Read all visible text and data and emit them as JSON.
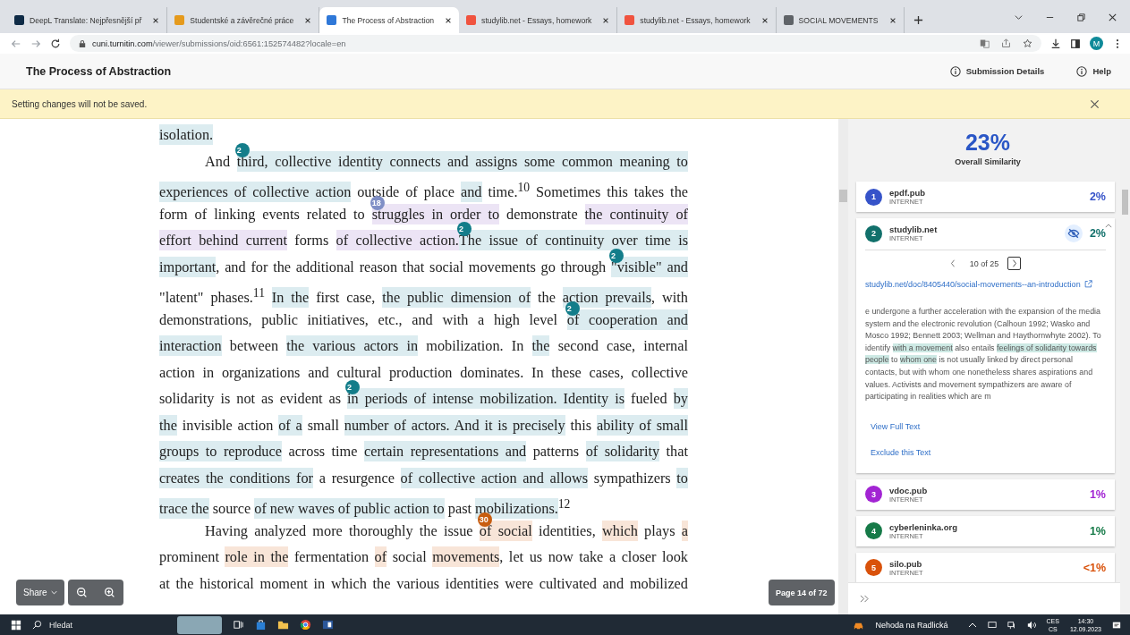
{
  "browser": {
    "tabs": [
      {
        "title": "DeepL Translate: Nejpřesnější př",
        "color": "#0f2b46",
        "selected": false
      },
      {
        "title": "Studentské a závěrečné práce",
        "color": "#e59a1c",
        "selected": false
      },
      {
        "title": "The Process of Abstraction",
        "color": "#2f78d8",
        "selected": true
      },
      {
        "title": "studylib.net - Essays, homework",
        "color": "#f0533f",
        "selected": false
      },
      {
        "title": "studylib.net - Essays, homework",
        "color": "#f0533f",
        "selected": false
      },
      {
        "title": "SOCIAL MOVEMENTS",
        "color": "#5f6368",
        "selected": false
      }
    ],
    "url": {
      "host": "cuni.turnitin.com",
      "path": "/viewer/submissions/oid:6561:152574482?locale=en"
    },
    "profile_initial": "M"
  },
  "app_header": {
    "title": "The Process of Abstraction",
    "actions": [
      "Submission Details",
      "Help"
    ]
  },
  "banner": {
    "message": "Setting changes will not be saved."
  },
  "document": {
    "lines": [
      {
        "indent": false,
        "last": true,
        "segments": [
          {
            "kind": "highlight",
            "text": "isolation.",
            "color": "#dcecf0"
          }
        ]
      },
      {
        "indent": true,
        "last": false,
        "segments": [
          {
            "kind": "text",
            "text": "And "
          },
          {
            "kind": "badge",
            "text": "2",
            "color": "#137d8a"
          },
          {
            "kind": "highlight",
            "text": "third, collective identity connects and assigns some common meaning to",
            "color": "#dcecf0"
          }
        ]
      },
      {
        "indent": false,
        "last": false,
        "segments": [
          {
            "kind": "highlight",
            "text": "experiences of collective action",
            "color": "#dcecf0"
          },
          {
            "kind": "text",
            "text": " outside of place "
          },
          {
            "kind": "highlight",
            "text": "and",
            "color": "#dcecf0"
          },
          {
            "kind": "text",
            "text": " time.$^{10}$ Sometimes this takes the"
          }
        ]
      },
      {
        "indent": false,
        "last": false,
        "segments": [
          {
            "kind": "text",
            "text": "form of linking events related to "
          },
          {
            "kind": "badge",
            "text": "18",
            "color": "#7f8fc6"
          },
          {
            "kind": "highlight",
            "text": "struggles in order to",
            "color": "#ece4f5"
          },
          {
            "kind": "text",
            "text": " demonstrate "
          },
          {
            "kind": "highlight",
            "text": "the continuity of",
            "color": "#ece4f5"
          }
        ]
      },
      {
        "indent": false,
        "last": false,
        "segments": [
          {
            "kind": "highlight",
            "text": "effort behind current",
            "color": "#ece4f5"
          },
          {
            "kind": "text",
            "text": " forms "
          },
          {
            "kind": "highlight",
            "text": "of collective action.",
            "color": "#ece4f5"
          },
          {
            "kind": "badge",
            "text": "2",
            "color": "#137d8a"
          },
          {
            "kind": "highlight",
            "text": "The issue of continuity over time is",
            "color": "#dcecf0"
          }
        ]
      },
      {
        "indent": false,
        "last": false,
        "segments": [
          {
            "kind": "highlight",
            "text": "important",
            "color": "#dcecf0"
          },
          {
            "kind": "text",
            "text": ", and for the additional reason that social movements go through "
          },
          {
            "kind": "badge",
            "text": "2",
            "color": "#137d8a"
          },
          {
            "kind": "highlight",
            "text": "\"visible\" and",
            "color": "#dcecf0"
          }
        ]
      },
      {
        "indent": false,
        "last": false,
        "segments": [
          {
            "kind": "text",
            "text": "\"latent\" phases.$^{11}$ "
          },
          {
            "kind": "highlight",
            "text": "In the",
            "color": "#dcecf0"
          },
          {
            "kind": "text",
            "text": " first case, "
          },
          {
            "kind": "highlight",
            "text": "the public dimension of",
            "color": "#dcecf0"
          },
          {
            "kind": "text",
            "text": " the "
          },
          {
            "kind": "highlight",
            "text": "action prevails",
            "color": "#dcecf0"
          },
          {
            "kind": "text",
            "text": ", with"
          }
        ]
      },
      {
        "indent": false,
        "last": false,
        "segments": [
          {
            "kind": "text",
            "text": "demonstrations, public initiatives, etc., and with a high level "
          },
          {
            "kind": "badge",
            "text": "2",
            "color": "#137d8a"
          },
          {
            "kind": "highlight",
            "text": "of cooperation and",
            "color": "#dcecf0"
          }
        ]
      },
      {
        "indent": false,
        "last": false,
        "segments": [
          {
            "kind": "highlight",
            "text": "interaction",
            "color": "#dcecf0"
          },
          {
            "kind": "text",
            "text": " between "
          },
          {
            "kind": "highlight",
            "text": "the various actors in",
            "color": "#dcecf0"
          },
          {
            "kind": "text",
            "text": " mobilization. In "
          },
          {
            "kind": "highlight",
            "text": "the",
            "color": "#dcecf0"
          },
          {
            "kind": "text",
            "text": " second case, internal"
          }
        ]
      },
      {
        "indent": false,
        "last": false,
        "segments": [
          {
            "kind": "text",
            "text": "action in organizations and cultural production dominates. In these cases, collective"
          }
        ]
      },
      {
        "indent": false,
        "last": false,
        "segments": [
          {
            "kind": "text",
            "text": "solidarity is not as evident as "
          },
          {
            "kind": "badge",
            "text": "2",
            "color": "#137d8a"
          },
          {
            "kind": "highlight",
            "text": "in periods of intense mobilization. Identity is",
            "color": "#dcecf0"
          },
          {
            "kind": "text",
            "text": " fueled "
          },
          {
            "kind": "highlight",
            "text": "by",
            "color": "#dcecf0"
          }
        ]
      },
      {
        "indent": false,
        "last": false,
        "segments": [
          {
            "kind": "highlight",
            "text": "the",
            "color": "#dcecf0"
          },
          {
            "kind": "text",
            "text": " invisible action "
          },
          {
            "kind": "highlight",
            "text": "of a",
            "color": "#dcecf0"
          },
          {
            "kind": "text",
            "text": " small "
          },
          {
            "kind": "highlight",
            "text": "number of actors. And it is precisely",
            "color": "#dcecf0"
          },
          {
            "kind": "text",
            "text": " this "
          },
          {
            "kind": "highlight",
            "text": "ability of small",
            "color": "#dcecf0"
          }
        ]
      },
      {
        "indent": false,
        "last": false,
        "segments": [
          {
            "kind": "highlight",
            "text": "groups to reproduce",
            "color": "#dcecf0"
          },
          {
            "kind": "text",
            "text": " across time "
          },
          {
            "kind": "highlight",
            "text": "certain representations and",
            "color": "#dcecf0"
          },
          {
            "kind": "text",
            "text": " patterns "
          },
          {
            "kind": "highlight",
            "text": "of solidarity",
            "color": "#dcecf0"
          },
          {
            "kind": "text",
            "text": " that"
          }
        ]
      },
      {
        "indent": false,
        "last": false,
        "segments": [
          {
            "kind": "highlight",
            "text": "creates the conditions for",
            "color": "#dcecf0"
          },
          {
            "kind": "text",
            "text": " a resurgence "
          },
          {
            "kind": "highlight",
            "text": "of collective action and allows",
            "color": "#dcecf0"
          },
          {
            "kind": "text",
            "text": " sympathizers "
          },
          {
            "kind": "highlight",
            "text": "to",
            "color": "#dcecf0"
          }
        ]
      },
      {
        "indent": false,
        "last": true,
        "segments": [
          {
            "kind": "highlight",
            "text": "trace the",
            "color": "#dcecf0"
          },
          {
            "kind": "text",
            "text": " source "
          },
          {
            "kind": "highlight",
            "text": "of new waves of public action to",
            "color": "#dcecf0"
          },
          {
            "kind": "text",
            "text": " past "
          },
          {
            "kind": "highlight",
            "text": "mobilizations.",
            "color": "#dcecf0"
          },
          {
            "kind": "text",
            "text": "$^{12}$"
          }
        ]
      },
      {
        "indent": true,
        "last": false,
        "segments": [
          {
            "kind": "text",
            "text": "Having analyzed more thoroughly the issue "
          },
          {
            "kind": "badge",
            "text": "30",
            "color": "#c85d0f"
          },
          {
            "kind": "highlight",
            "text": "of social",
            "color": "#f8e5d8"
          },
          {
            "kind": "text",
            "text": " identities, "
          },
          {
            "kind": "highlight",
            "text": "which",
            "color": "#f8e5d8"
          },
          {
            "kind": "text",
            "text": " plays "
          },
          {
            "kind": "highlight",
            "text": "a",
            "color": "#f8e5d8"
          }
        ]
      },
      {
        "indent": false,
        "last": false,
        "segments": [
          {
            "kind": "text",
            "text": "prominent "
          },
          {
            "kind": "highlight",
            "text": "role in the",
            "color": "#f8e5d8"
          },
          {
            "kind": "text",
            "text": " fermentation "
          },
          {
            "kind": "highlight",
            "text": "of",
            "color": "#f8e5d8"
          },
          {
            "kind": "text",
            "text": " social "
          },
          {
            "kind": "highlight",
            "text": "movements",
            "color": "#f8e5d8"
          },
          {
            "kind": "text",
            "text": ", let us now take a closer look"
          }
        ]
      },
      {
        "indent": false,
        "last": false,
        "segments": [
          {
            "kind": "text",
            "text": "at the historical moment in which the various identities were cultivated and mobilized"
          }
        ]
      }
    ],
    "share_label": "Share",
    "page_indicator": "Page 14 of 72"
  },
  "similarity_panel": {
    "score": "23%",
    "label": "Overall Similarity",
    "sources": [
      {
        "number": "1",
        "name": "epdf.pub",
        "type": "INTERNET",
        "percent": "2%",
        "color": "#3653c9",
        "expanded": false
      },
      {
        "number": "2",
        "name": "studylib.net",
        "type": "INTERNET",
        "percent": "2%",
        "color": "#11706b",
        "expanded": true
      },
      {
        "number": "3",
        "name": "vdoc.pub",
        "type": "INTERNET",
        "percent": "1%",
        "color": "#a224d3",
        "expanded": false
      },
      {
        "number": "4",
        "name": "cyberleninka.org",
        "type": "INTERNET",
        "percent": "1%",
        "color": "#167a48",
        "expanded": false
      },
      {
        "number": "5",
        "name": "silo.pub",
        "type": "INTERNET",
        "percent": "<1%",
        "color": "#d9520b",
        "expanded": false
      }
    ],
    "detail": {
      "pager": "10 of 25",
      "link": "studylib.net/doc/8405440/social-movements--an-introduction",
      "excerpt": [
        {
          "text": "e undergone a further acceleration with the expansion of the media system and the electronic revolution (Calhoun 1992; Wasko and Mosco 1992; Bennett 2003; Wellman and Haythornwhyte 2002). To identify ",
          "highlighted": false
        },
        {
          "text": "with a movement",
          "highlighted": true
        },
        {
          "text": " also entails ",
          "highlighted": false
        },
        {
          "text": "feelings of solidarity towards people",
          "highlighted": true
        },
        {
          "text": " to ",
          "highlighted": false
        },
        {
          "text": "whom one",
          "highlighted": true
        },
        {
          "text": " is not usually linked by direct personal contacts, but with whom one nonetheless shares aspirations and values. Activists and movement sympathizers are aware of participating in realities which are m",
          "highlighted": false
        }
      ],
      "actions": [
        "View Full Text",
        "Exclude this Text"
      ]
    }
  },
  "taskbar": {
    "search": "Hledat",
    "notification": "Nehoda na Radlická",
    "language": "CES",
    "layout": "CS",
    "time": "14:30",
    "date": "12.09.2023"
  }
}
